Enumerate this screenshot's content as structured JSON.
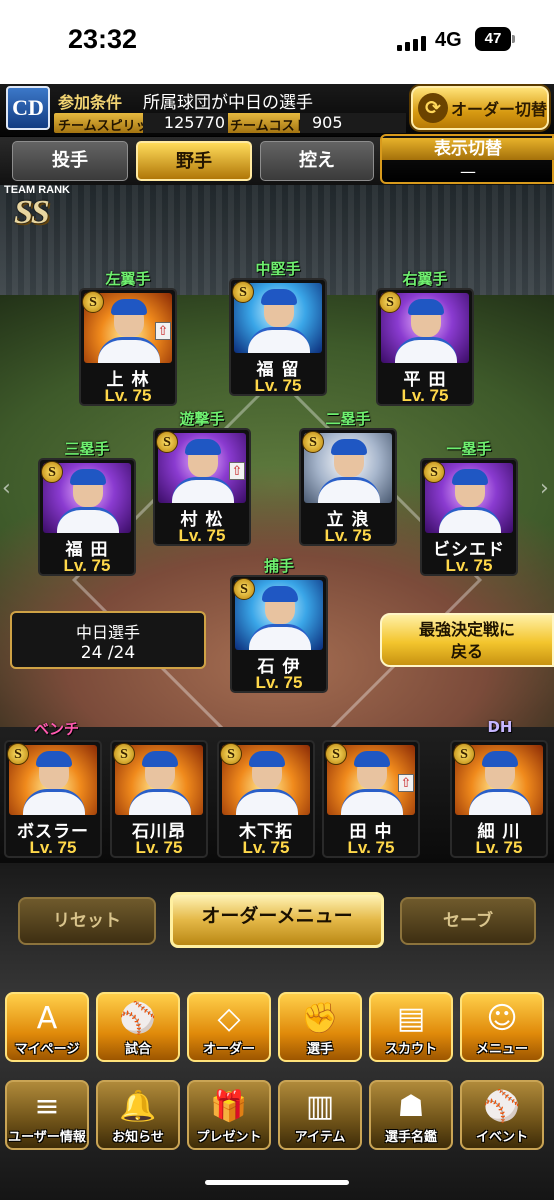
{
  "status_bar": {
    "time": "23:32",
    "network": "4G",
    "battery": "47"
  },
  "header": {
    "team_logo_text": "CD",
    "condition_label": "参加条件",
    "condition_text": "所属球団が中日の選手",
    "team_spirits_label": "チームスピリッツ",
    "team_spirits_value": "125770",
    "team_cost_label": "チームコスト",
    "team_cost_value": "905",
    "order_switch_label": "オーダー切替"
  },
  "tabs": [
    {
      "label": "投手",
      "active": false
    },
    {
      "label": "野手",
      "active": true
    },
    {
      "label": "控え",
      "active": false
    }
  ],
  "view_toggle": {
    "label": "表示切替",
    "value": "—"
  },
  "team_rank": {
    "label": "TEAM RANK",
    "value": "SS"
  },
  "field_players": [
    {
      "position": "左翼手",
      "name": "上 林",
      "level": "Lv. 75",
      "bg": "fire",
      "upgrade": true
    },
    {
      "position": "中堅手",
      "name": "福 留",
      "level": "Lv. 75",
      "bg": "blue",
      "upgrade": false
    },
    {
      "position": "右翼手",
      "name": "平 田",
      "level": "Lv. 75",
      "bg": "purple",
      "upgrade": false
    },
    {
      "position": "遊撃手",
      "name": "村 松",
      "level": "Lv. 75",
      "bg": "purple",
      "upgrade": true
    },
    {
      "position": "二塁手",
      "name": "立 浪",
      "level": "Lv. 75",
      "bg": "silver",
      "upgrade": false
    },
    {
      "position": "三塁手",
      "name": "福 田",
      "level": "Lv. 75",
      "bg": "purple",
      "upgrade": false
    },
    {
      "position": "一塁手",
      "name": "ビシエド",
      "level": "Lv. 75",
      "bg": "purple",
      "upgrade": false
    },
    {
      "position": "捕手",
      "name": "石 伊",
      "level": "Lv. 75",
      "bg": "blue",
      "upgrade": false
    }
  ],
  "chunichi_count": {
    "label": "中日選手",
    "value": "24 /24"
  },
  "back_button": {
    "line1": "最強決定戦に",
    "line2": "戻る"
  },
  "bench": {
    "label": "ベンチ",
    "players": [
      {
        "name": "ボスラー",
        "level": "Lv. 75",
        "bg": "fire"
      },
      {
        "name": "石川昂",
        "level": "Lv. 75",
        "bg": "fire"
      },
      {
        "name": "木下拓",
        "level": "Lv. 75",
        "bg": "fire"
      },
      {
        "name": "田 中",
        "level": "Lv. 75",
        "bg": "fire",
        "upgrade": true
      }
    ]
  },
  "dh": {
    "label": "DH",
    "name": "細 川",
    "level": "Lv. 75",
    "bg": "fire"
  },
  "menu_buttons": {
    "reset": "リセット",
    "order_menu": "オーダーメニュー",
    "save": "セーブ"
  },
  "nav_row1": [
    {
      "label": "マイページ",
      "icon": "A"
    },
    {
      "label": "試合",
      "icon": "⚾"
    },
    {
      "label": "オーダー",
      "icon": "◇"
    },
    {
      "label": "選手",
      "icon": "✊"
    },
    {
      "label": "スカウト",
      "icon": "▤"
    },
    {
      "label": "メニュー",
      "icon": "☺"
    }
  ],
  "nav_row2": [
    {
      "label": "ユーザー情報",
      "icon": "≡"
    },
    {
      "label": "お知らせ",
      "icon": "🔔"
    },
    {
      "label": "プレゼント",
      "icon": "🎁"
    },
    {
      "label": "アイテム",
      "icon": "▥"
    },
    {
      "label": "選手名鑑",
      "icon": "☗"
    },
    {
      "label": "イベント",
      "icon": "⚾"
    }
  ]
}
